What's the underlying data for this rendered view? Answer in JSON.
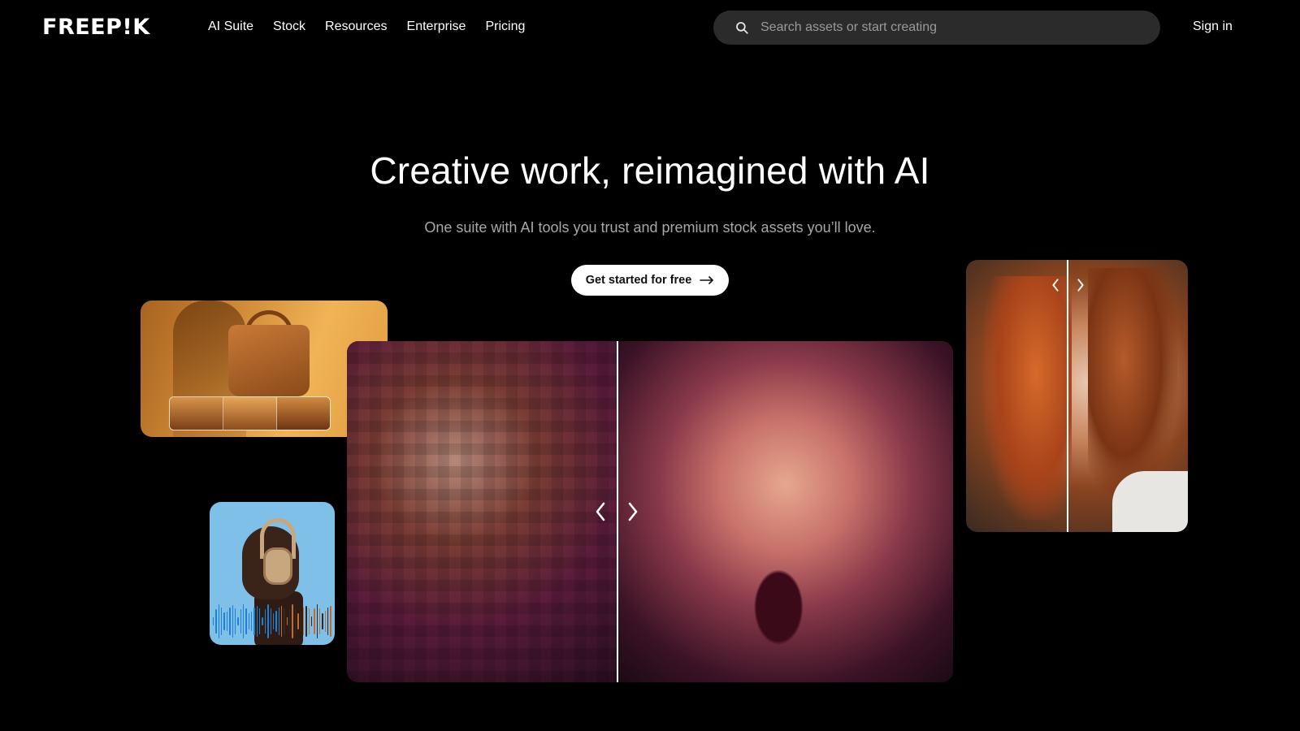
{
  "header": {
    "logo_text": "FREEP!K",
    "nav": [
      {
        "label": "AI Suite"
      },
      {
        "label": "Stock"
      },
      {
        "label": "Resources"
      },
      {
        "label": "Enterprise"
      },
      {
        "label": "Pricing"
      }
    ],
    "search": {
      "placeholder": "Search assets or start creating",
      "icon": "search-icon"
    },
    "signin_label": "Sign in"
  },
  "hero": {
    "title": "Creative work, reimagined with AI",
    "subtitle": "One suite with AI tools you trust and premium stock assets you’ll love.",
    "cta_label": "Get started for free",
    "cta_icon": "arrow-right-icon"
  },
  "colors": {
    "background": "#000000",
    "search_bg": "#2b2b2b",
    "cta_bg": "#ffffff",
    "subtitle": "#a8a8a8"
  }
}
